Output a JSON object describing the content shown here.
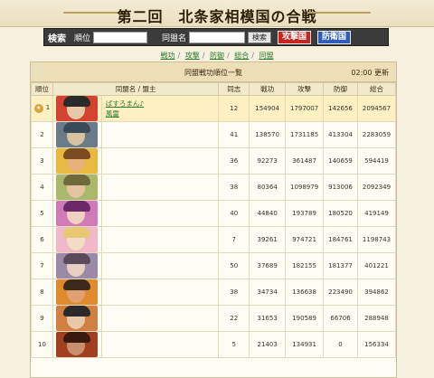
{
  "page": {
    "title": "第二回　北条家相模国の合戦"
  },
  "search": {
    "label": "検索",
    "rank_label": "順位",
    "alliance_label": "同盟名",
    "search_button": "検索",
    "attack_button": "攻撃国",
    "defense_button": "防衛国"
  },
  "tabs": [
    {
      "label": "戦功"
    },
    {
      "label": "攻撃"
    },
    {
      "label": "防御"
    },
    {
      "label": "総合"
    },
    {
      "label": "同盟"
    }
  ],
  "board": {
    "title": "同盟戦功順位一覧",
    "update_time": "02:00",
    "update_label": "更新",
    "columns": [
      "順位",
      "同盟名 / 盟主",
      "同志",
      "戦功",
      "攻撃",
      "防御",
      "総合"
    ]
  },
  "rows": [
    {
      "rank": "1",
      "alliance": "ばすろまん♪",
      "leader": "風雷",
      "members": "12",
      "merit": "154904",
      "attack": "1797007",
      "defense": "142656",
      "total": "2094567",
      "skin": "#e9c8a8",
      "hair": "#2a2a2a",
      "bg": "#d4432f"
    },
    {
      "rank": "2",
      "alliance": "",
      "leader": "",
      "members": "41",
      "merit": "138570",
      "attack": "1731185",
      "defense": "413304",
      "total": "2283059",
      "skin": "#d9c2a0",
      "hair": "#3b4a5a",
      "bg": "#6a7b8a"
    },
    {
      "rank": "3",
      "alliance": "",
      "leader": "",
      "members": "36",
      "merit": "92273",
      "attack": "361487",
      "defense": "140659",
      "total": "594419",
      "skin": "#e8b07a",
      "hair": "#7a4a20",
      "bg": "#e8b840"
    },
    {
      "rank": "4",
      "alliance": "",
      "leader": "",
      "members": "38",
      "merit": "80364",
      "attack": "1098979",
      "defense": "913006",
      "total": "2092349",
      "skin": "#e3c3a0",
      "hair": "#6e6a3c",
      "bg": "#a9b86a"
    },
    {
      "rank": "5",
      "alliance": "",
      "leader": "",
      "members": "40",
      "merit": "44840",
      "attack": "193789",
      "defense": "180520",
      "total": "419149",
      "skin": "#f0d0c0",
      "hair": "#6a2a6a",
      "bg": "#d07ab8"
    },
    {
      "rank": "6",
      "alliance": "",
      "leader": "",
      "members": "7",
      "merit": "39261",
      "attack": "974721",
      "defense": "184761",
      "total": "1198743",
      "skin": "#f3dcc5",
      "hair": "#e8c870",
      "bg": "#f0b8c8"
    },
    {
      "rank": "7",
      "alliance": "",
      "leader": "",
      "members": "50",
      "merit": "37689",
      "attack": "182155",
      "defense": "181377",
      "total": "401221",
      "skin": "#e8d0c0",
      "hair": "#5a4a5a",
      "bg": "#9a8aa8"
    },
    {
      "rank": "8",
      "alliance": "",
      "leader": "",
      "members": "38",
      "merit": "34734",
      "attack": "136638",
      "defense": "223490",
      "total": "394862",
      "skin": "#e0a070",
      "hair": "#3a2a1a",
      "bg": "#e08a30"
    },
    {
      "rank": "9",
      "alliance": "",
      "leader": "",
      "members": "22",
      "merit": "31653",
      "attack": "190589",
      "defense": "66706",
      "total": "288948",
      "skin": "#e8c8a8",
      "hair": "#2a2a2a",
      "bg": "#d08040"
    },
    {
      "rank": "10",
      "alliance": "",
      "leader": "",
      "members": "5",
      "merit": "21403",
      "attack": "134931",
      "defense": "0",
      "total": "156334",
      "skin": "#c89070",
      "hair": "#3a1a10",
      "bg": "#a04020"
    }
  ]
}
